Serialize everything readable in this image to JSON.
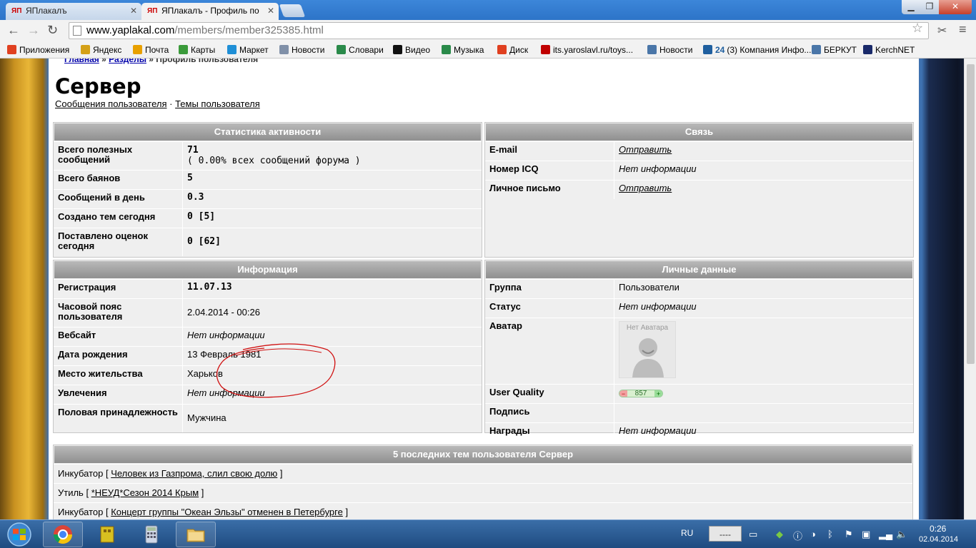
{
  "browser": {
    "tabs": [
      {
        "label": "ЯПлакалъ",
        "favicon": "ЯП"
      },
      {
        "label": "ЯПлакалъ - Профиль по",
        "favicon": "ЯП"
      }
    ],
    "url_host": "www.yaplakal.com",
    "url_path": "/members/member325385.html",
    "bookmarks": [
      {
        "label": "Приложения",
        "color": "#e04020"
      },
      {
        "label": "Яндекс",
        "color": "#d4a017"
      },
      {
        "label": "Почта",
        "color": "#e8a000"
      },
      {
        "label": "Карты",
        "color": "#3a9a3a"
      },
      {
        "label": "Маркет",
        "color": "#1f8fd6"
      },
      {
        "label": "Новости",
        "color": "#8090a8"
      },
      {
        "label": "Словари",
        "color": "#2a8a4a"
      },
      {
        "label": "Видео",
        "color": "#111111"
      },
      {
        "label": "Музыка",
        "color": "#2a8a4a"
      },
      {
        "label": "Диск",
        "color": "#e04020"
      },
      {
        "label": "its.yaroslavl.ru/toys...",
        "color": "#c00000"
      },
      {
        "label": "Новости",
        "color": "#4a76a8"
      },
      {
        "label": "(3) Компания Инфо...",
        "color": "#1f5f9f",
        "prefix": "24"
      },
      {
        "label": "БЕРКУТ",
        "color": "#4a76a8"
      },
      {
        "label": "KerchNET",
        "color": "#1a2a6a"
      }
    ]
  },
  "page": {
    "breadcrumb": {
      "home": "Главная",
      "sections": "Разделы",
      "current": "Профиль пользователя"
    },
    "title": "Сервер",
    "link_messages": "Сообщения пользователя",
    "link_topics": "Темы пользователя",
    "separator": "·"
  },
  "activity": {
    "header": "Статистика активности",
    "rows": [
      {
        "k": "Всего полезных сообщений",
        "v": "71",
        "v2": "( 0.00% всех сообщений форума )"
      },
      {
        "k": "Всего баянов",
        "v": "5"
      },
      {
        "k": "Сообщений в день",
        "v": "0.3"
      },
      {
        "k": "Создано тем сегодня",
        "v": "0 [5]"
      },
      {
        "k": "Поставлено оценок сегодня",
        "v": "0 [62]"
      }
    ]
  },
  "contact": {
    "header": "Связь",
    "rows": [
      {
        "k": "E-mail",
        "v": "Отправить",
        "link": true
      },
      {
        "k": "Номер ICQ",
        "v": "Нет информации"
      },
      {
        "k": "Личное письмо",
        "v": "Отправить",
        "link": true
      }
    ]
  },
  "info": {
    "header": "Информация",
    "rows": [
      {
        "k": "Регистрация",
        "v": "11.07.13"
      },
      {
        "k": "Часовой пояс пользователя",
        "v": "2.04.2014 - 00:26"
      },
      {
        "k": "Вебсайт",
        "v": "Нет информации"
      },
      {
        "k": "Дата рождения",
        "v": "13 Февраль 1981"
      },
      {
        "k": "Место жительства",
        "v": "Харьков"
      },
      {
        "k": "Увлечения",
        "v": "Нет информации"
      },
      {
        "k": "Половая принадлежность",
        "v": "Мужчина"
      }
    ]
  },
  "personal": {
    "header": "Личные данные",
    "rows": [
      {
        "k": "Группа",
        "v": "Пользователи"
      },
      {
        "k": "Статус",
        "v": "Нет информации"
      },
      {
        "k": "Аватар",
        "v": "Нет Аватара"
      },
      {
        "k": "User Quality",
        "v": "857"
      },
      {
        "k": "Подпись",
        "v": ""
      },
      {
        "k": "Награды",
        "v": "Нет информации"
      }
    ]
  },
  "topics": {
    "header": "5 последних тем пользователя Сервер",
    "rows": [
      {
        "section": "Инкубатор",
        "title": "Человек из Газпрома, слил свою долю"
      },
      {
        "section": "Утиль",
        "title": "*НЕУД*Сезон 2014 Крым"
      },
      {
        "section": "Инкубатор",
        "title": "Концерт группы \"Океан Эльзы\" отменен в Петербурге"
      }
    ]
  },
  "taskbar": {
    "lang": "RU",
    "time": "0:26",
    "date": "02.04.2014",
    "tray_field": "----"
  }
}
